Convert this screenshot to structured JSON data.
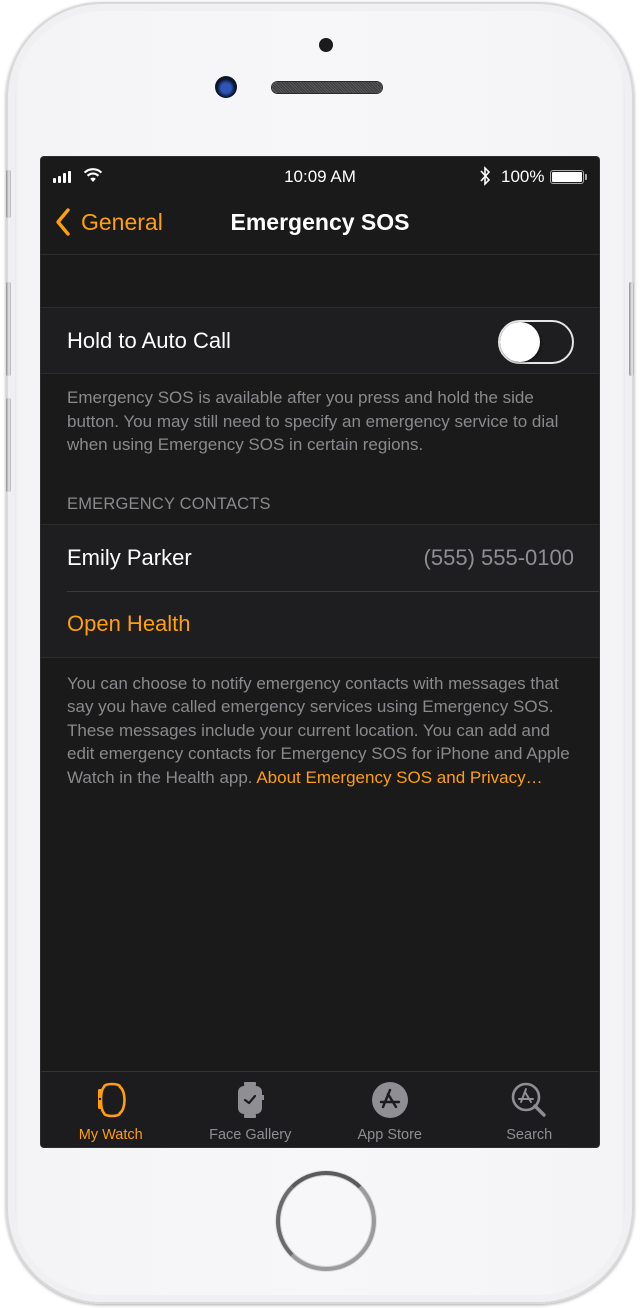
{
  "status_bar": {
    "time": "10:09 AM",
    "battery_percent": "100%",
    "icons": [
      "signal-icon",
      "wifi-icon",
      "bluetooth-icon",
      "battery-icon"
    ]
  },
  "nav": {
    "back_label": "General",
    "title": "Emergency SOS"
  },
  "settings": {
    "auto_call": {
      "label": "Hold to Auto Call",
      "enabled": false
    },
    "auto_call_footer": "Emergency SOS is available after you press and hold the side button. You may still need to specify an emergency service to dial when using Emergency SOS in certain regions.",
    "contacts_header": "EMERGENCY CONTACTS",
    "contacts": [
      {
        "name": "Emily Parker",
        "phone": "(555) 555-0100"
      }
    ],
    "open_health_label": "Open Health",
    "contacts_footer": "You can choose to notify emergency contacts with messages that say you have called emergency services using Emergency SOS. These messages include your current location. You can add and edit emergency contacts for Emergency SOS for iPhone and Apple Watch in the Health app. ",
    "privacy_link": "About Emergency SOS and Privacy…"
  },
  "tab_bar": {
    "tabs": [
      {
        "label": "My Watch",
        "icon": "watch-icon",
        "active": true
      },
      {
        "label": "Face Gallery",
        "icon": "face-gallery-icon",
        "active": false
      },
      {
        "label": "App Store",
        "icon": "app-store-icon",
        "active": false
      },
      {
        "label": "Search",
        "icon": "search-icon",
        "active": false
      }
    ]
  },
  "colors": {
    "accent": "#ff9f0a",
    "background": "#1a1a1a",
    "cell_background": "#1e1e20",
    "secondary_text": "#8a8a8e"
  }
}
